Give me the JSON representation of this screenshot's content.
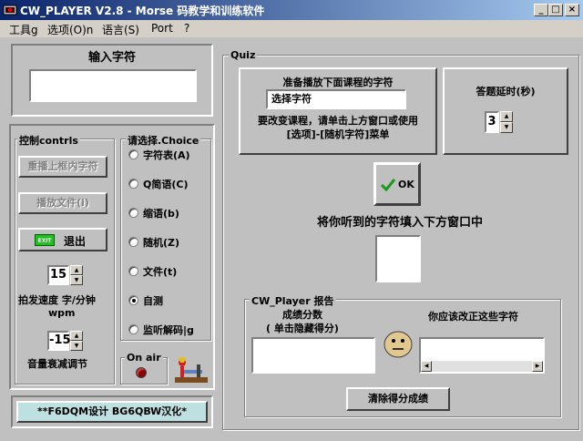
{
  "window": {
    "title": "CW_PLAYER  V2.8 - Morse 码教学和训练软件"
  },
  "menu": [
    "工具g",
    "选项(O)n",
    "语言(S)",
    "Port",
    "?"
  ],
  "input_panel": {
    "title": "输入字符",
    "value": ""
  },
  "control": {
    "title": "控制contrls",
    "replay_button": "重播上框内字符",
    "play_file_button": "播放文件(i)",
    "exit_icon": "EXIT",
    "exit_button": "退出",
    "speed_value": "15",
    "speed_label": "拍发速度 字/分钟",
    "speed_unit": "wpm",
    "volume_value": "-15",
    "volume_label": "音量衰减调节"
  },
  "choice": {
    "title": "请选择.Choice",
    "options": [
      {
        "label": "字符表(A)",
        "selected": false
      },
      {
        "label": "Q简语(C)",
        "selected": false
      },
      {
        "label": "缩语(b)",
        "selected": false
      },
      {
        "label": "随机(Z)",
        "selected": false
      },
      {
        "label": "文件(t)",
        "selected": false
      },
      {
        "label": "自测",
        "selected": true
      },
      {
        "label": "监听解码|g",
        "selected": false
      }
    ]
  },
  "onair": {
    "title": "On air"
  },
  "credits": "**F6DQM设计 BG6QBW汉化*",
  "quiz": {
    "title": "Quiz",
    "prepare_label": "准备播放下面课程的字符",
    "course_value": "选择字符",
    "instructions_1": "要改变课程，请单击上方窗口或使用",
    "instructions_2": "[选项]-[随机字符]菜单",
    "delay_label": "答题延时(秒)",
    "delay_value": "3",
    "ok_button": "OK",
    "answer_prompt": "将你听到的字符填入下方窗口中"
  },
  "report": {
    "title": "CW_Player 报告",
    "score_label_1": "成绩分数",
    "score_label_2": "( 单击隐藏得分)",
    "correct_label": "你应该改正这些字符",
    "clear_button": "清除得分成绩"
  },
  "colors": {
    "title_start": "#0a246a",
    "title_end": "#a6caf0",
    "face": "#c0c0c0",
    "credits_bg": "#bfe0e0",
    "ok_check": "#1a9a1a",
    "led": "#8a0000"
  }
}
